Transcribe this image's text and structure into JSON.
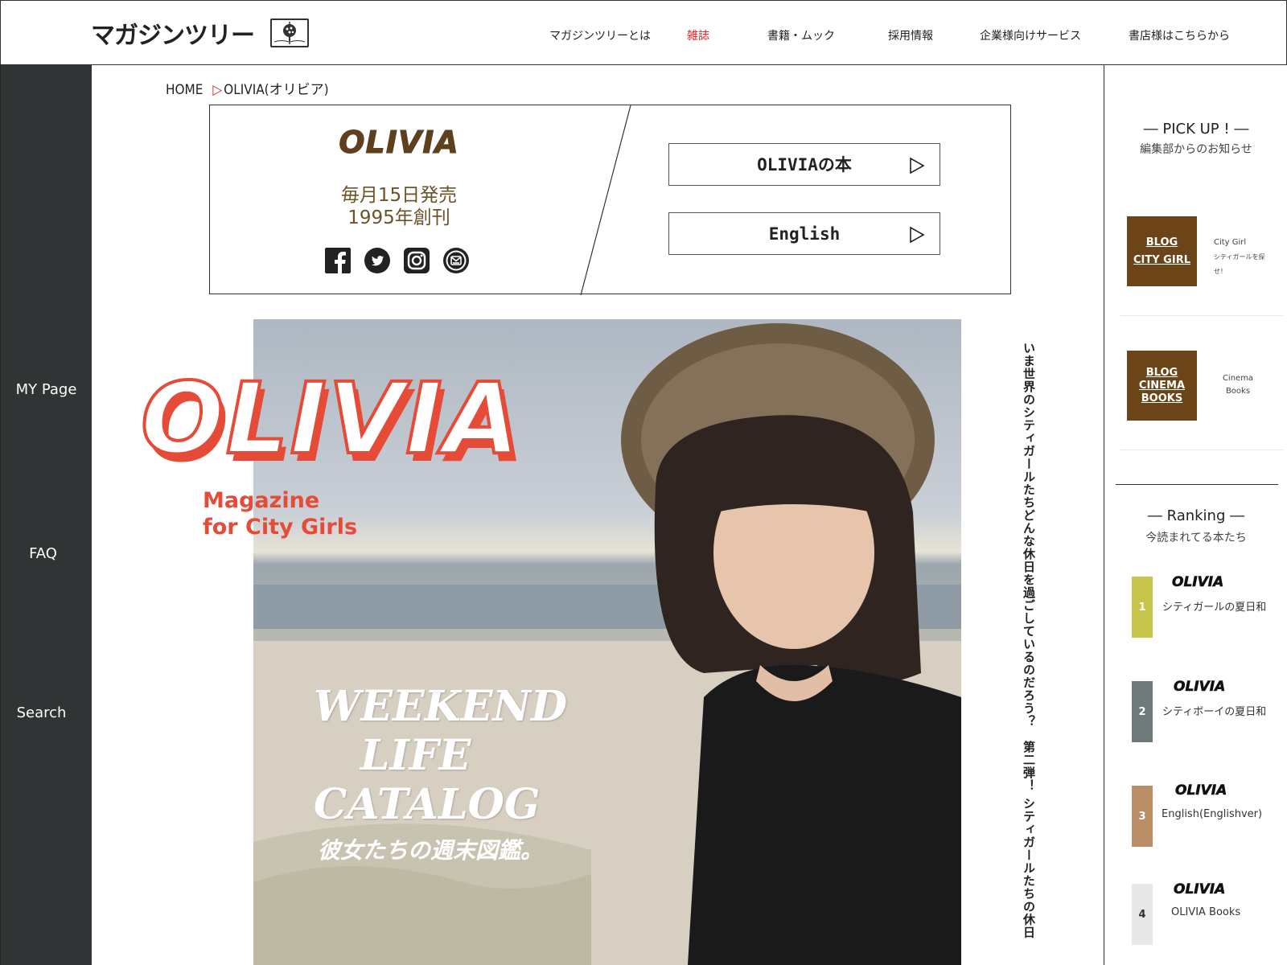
{
  "header": {
    "brand": "マガジンツリー",
    "nav": [
      "マガジンツリーとは",
      "雑誌",
      "書籍・ムック",
      "採用情報",
      "企業様向けサービス",
      "書店様はこちらから"
    ],
    "active_nav": "雑誌"
  },
  "sidebar": {
    "items": [
      "MY Page",
      "FAQ",
      "Search"
    ]
  },
  "breadcrumb": {
    "home": "HOME",
    "separator": "▷",
    "current": "OLIVIA(オリビア)"
  },
  "magazine": {
    "logo": "OLIVIA",
    "release": "毎月15日発売",
    "founded": "1995年創刊",
    "social_icons": [
      "facebook-icon",
      "twitter-icon",
      "instagram-icon",
      "mail-icon"
    ],
    "buttons": [
      "OLIVIAの本",
      "English"
    ],
    "arrow": "▷"
  },
  "cover": {
    "logo": "OLIVIA",
    "tagline_1": "Magazine",
    "tagline_2": "for City Girls",
    "title_1": "WEEKEND",
    "title_2": "LIFE",
    "title_3": "CATALOG",
    "subtitle": "彼女たちの週末図鑑。"
  },
  "vertical_copy": "いま世界のシティガールたちどんな休日を過ごしているのだろう？　第二弾！ シティガールたちの休日",
  "pickup": {
    "title": "― PICK UP ! ―",
    "subtitle": "編集部からのお知らせ",
    "items": [
      {
        "line1": "BLOG",
        "line2": "CITY GIRL",
        "line3": "",
        "desc1": "City Girl",
        "desc2": "シティガールを探せ！"
      },
      {
        "line1": "BLOG",
        "line2": "CINEMA",
        "line3": "BOOKS",
        "desc1": "Cinema",
        "desc2": "Books"
      }
    ]
  },
  "ranking": {
    "title": "― Ranking ―",
    "subtitle": "今読まれてる本たち",
    "colors": [
      "#c9c44a",
      "#6e7a7a",
      "#b98d66",
      "#e8e8e8"
    ],
    "items": [
      {
        "rank": "1",
        "logo": "OLIVIA",
        "title": "シティガールの夏日和"
      },
      {
        "rank": "2",
        "logo": "OLIVIA",
        "title": "シティボーイの夏日和"
      },
      {
        "rank": "3",
        "logo": "OLIVIA",
        "title": "English(Englishver)"
      },
      {
        "rank": "4",
        "logo": "OLIVIA",
        "title": "OLIVIA Books"
      }
    ]
  }
}
